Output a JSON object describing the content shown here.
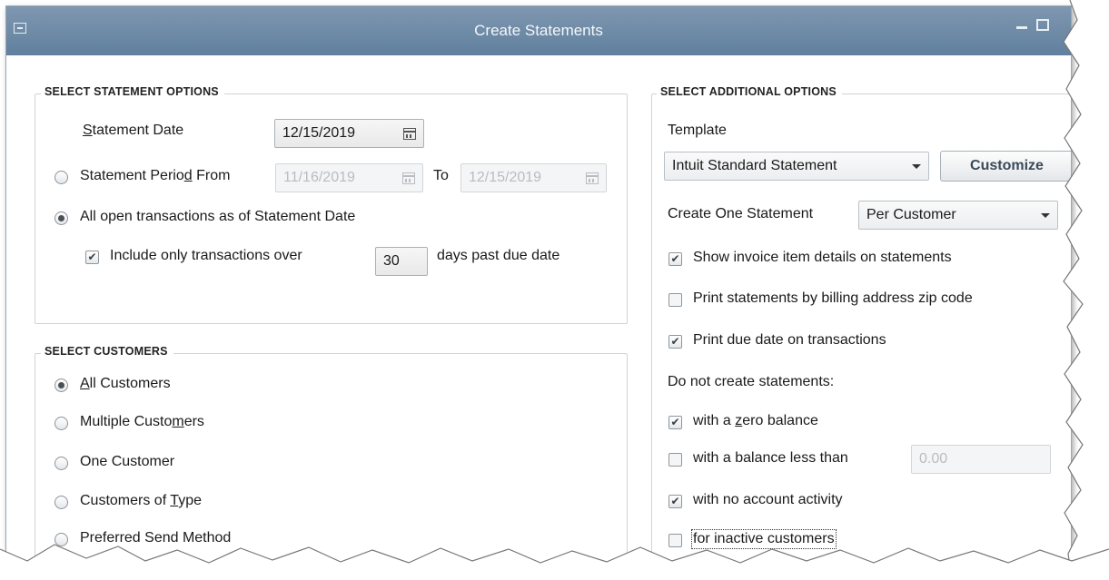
{
  "window": {
    "title": "Create Statements"
  },
  "statement_options": {
    "group_label": "SELECT STATEMENT OPTIONS",
    "statement_date_label_u": "S",
    "statement_date_label_rest": "tatement Date",
    "statement_date_value": "12/15/2019",
    "period_label_pre": "Statement Perio",
    "period_label_u": "d",
    "period_label_post": " From",
    "period_from_value": "11/16/2019",
    "to_label": "To",
    "period_to_value": "12/15/2019",
    "all_open_label": "All open transactions as of Statement Date",
    "include_label": "Include only transactions over",
    "days_value": "30",
    "days_suffix": "days past due date"
  },
  "customers": {
    "group_label": "SELECT CUSTOMERS",
    "all_u": "A",
    "all_rest": "ll Customers",
    "multiple_pre": "Multiple Custo",
    "multiple_u": "m",
    "multiple_post": "ers",
    "one": "One Customer",
    "type_pre": "Customers of ",
    "type_u": "T",
    "type_post": "ype",
    "preferred": "Preferred Send Method"
  },
  "additional": {
    "group_label": "SELECT ADDITIONAL OPTIONS",
    "template_label": "Template",
    "template_value": "Intuit Standard Statement",
    "customize_label": "Customize",
    "create_one_label": "Create One Statement",
    "create_one_value": "Per Customer",
    "show_invoice_label": "Show invoice item details on statements",
    "print_zip_label": "Print statements by billing address zip code",
    "print_due_label": "Print due date on transactions",
    "do_not_create_label": "Do not create statements:",
    "zero_pre": "with a ",
    "zero_u": "z",
    "zero_post": "ero balance",
    "balance_less_label": "with a balance less than",
    "balance_less_value": "0.00",
    "no_activity_label": "with no account activity",
    "inactive_label": "for inactive customers"
  }
}
